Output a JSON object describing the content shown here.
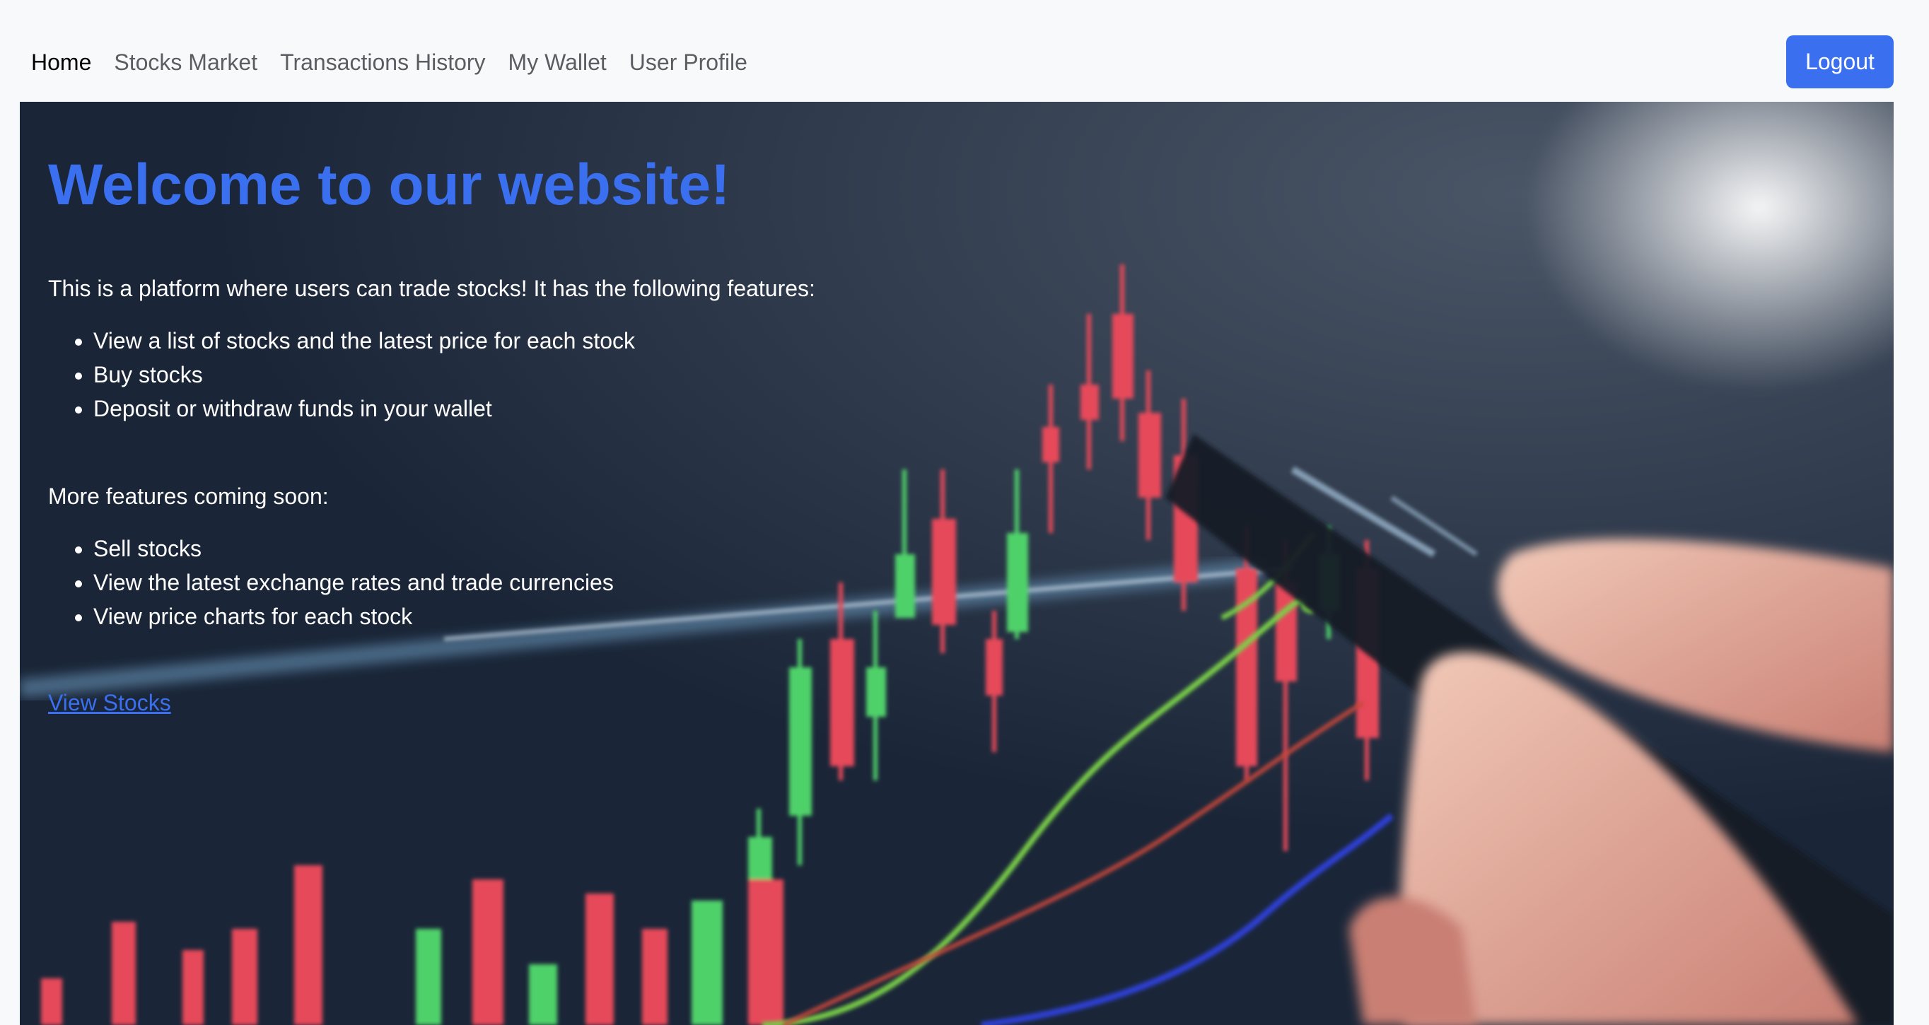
{
  "nav": {
    "links": [
      {
        "label": "Home",
        "active": true
      },
      {
        "label": "Stocks Market",
        "active": false
      },
      {
        "label": "Transactions History",
        "active": false
      },
      {
        "label": "My Wallet",
        "active": false
      },
      {
        "label": "User Profile",
        "active": false
      }
    ],
    "logout_label": "Logout"
  },
  "hero": {
    "title": "Welcome to our website!",
    "intro": "This is a platform where users can trade stocks! It has the following features:",
    "features": [
      "View a list of stocks and the latest price for each stock",
      "Buy stocks",
      "Deposit or withdraw funds in your wallet"
    ],
    "coming_soon_title": "More features coming soon:",
    "coming_soon": [
      "Sell stocks",
      "View the latest exchange rates and trade currencies",
      "View price charts for each stock"
    ],
    "link_label": "View Stocks"
  },
  "colors": {
    "accent": "#3a6ff0",
    "navbar_bg": "#f8f9fa",
    "hero_bg": "#1c2a3d",
    "candle_up": "#4fd16a",
    "candle_down": "#e64a5a"
  }
}
